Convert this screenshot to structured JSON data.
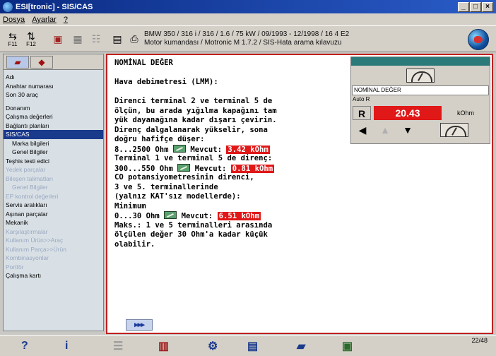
{
  "window": {
    "title": "ESI[tronic] - SIS/CAS",
    "min": "_",
    "max": "□",
    "close": "×"
  },
  "menu": {
    "file": "Dosya",
    "settings": "Ayarlar",
    "help": "?"
  },
  "toolbar": {
    "vehicle_line1": "BMW 350 / 316 i / 316 / 1.6 / 75 kW / 09/1993 - 12/1998 / 16 4 E2",
    "vehicle_line2": "Motor kumandası / Motronic M 1.7.2 / SIS-Hata arama kılavuzu",
    "f11": "F11",
    "f12": "F12"
  },
  "sidebar": {
    "items": [
      {
        "label": "Adı",
        "type": "normal"
      },
      {
        "label": "Anahtar numarası",
        "type": "normal"
      },
      {
        "label": "Son 30 araç",
        "type": "normal"
      },
      {
        "label": "",
        "type": "gap"
      },
      {
        "label": "Donanım",
        "type": "normal"
      },
      {
        "label": "Çalışma değerleri",
        "type": "normal"
      },
      {
        "label": "Bağlantı planları",
        "type": "normal"
      },
      {
        "label": "SIS/CAS",
        "type": "selected"
      },
      {
        "label": "Marka bilgileri",
        "type": "sub"
      },
      {
        "label": "Genel Bilgiler",
        "type": "sub"
      },
      {
        "label": "Teşhis testi edici",
        "type": "normal"
      },
      {
        "label": "Yedek parçalar",
        "type": "disabled"
      },
      {
        "label": "Bileşen talimatları",
        "type": "disabled"
      },
      {
        "label": "Genel Bilgiler",
        "type": "disabled-sub"
      },
      {
        "label": "EP kontrol değerleri",
        "type": "disabled"
      },
      {
        "label": "Servis aralıkları",
        "type": "normal"
      },
      {
        "label": "Aşınan parçalar",
        "type": "normal"
      },
      {
        "label": "Mekanik",
        "type": "normal"
      },
      {
        "label": "Karşılaştırmalar",
        "type": "disabled"
      },
      {
        "label": "Kullanım Ürün>>Araç",
        "type": "disabled"
      },
      {
        "label": "Kullanım Parça>>Ürün",
        "type": "disabled"
      },
      {
        "label": "Kombinasyonlar",
        "type": "disabled"
      },
      {
        "label": "Portför",
        "type": "disabled"
      },
      {
        "label": "Çalışma kartı",
        "type": "normal"
      }
    ]
  },
  "content": {
    "heading": "NOMİNAL DEĞER",
    "subtitle": "Hava debimetresi (LMM):",
    "para1": [
      "Direnci terminal 2 ve terminal 5 de",
      "ölçün, bu arada yığılma kapağını tam",
      "yük dayanağına kadar dışarı çevirin.",
      "Direnç dalgalanarak yükselir, sona",
      "doğru hafifçe düşer:"
    ],
    "r1_range": "8...2500 Ohm",
    "r1_label": "Mevcut:",
    "r1_value": "3.42 kOhm",
    "mid1": "Terminal 1 ve terminal 5 de direnç:",
    "r2_range": "300...550 Ohm",
    "r2_label": "Mevcut:",
    "r2_value": "0.81 kOhm",
    "para2": [
      "CO potansiyometresinin direnci,",
      "3 ve 5. terminallerinde",
      "(yalnız KAT'sız modellerde):",
      "Minimum"
    ],
    "r3_range": "0...30 Ohm",
    "r3_label": "Mevcut:",
    "r3_value": "6.51 kOhm",
    "para3": [
      "Maks.: 1 ve 5 terminalleri arasında",
      "ölçülen değer 30 Ohm'a kadar küçük",
      "olabilir."
    ],
    "next": "▸▸▸"
  },
  "meter": {
    "label": "NOMİNAL DEĞER",
    "mode": "Auto R",
    "range": "R",
    "value": "20.43",
    "unit": "kOhm"
  },
  "bottom": {
    "help_key": "?",
    "info_key": "i",
    "page": "22/48"
  }
}
